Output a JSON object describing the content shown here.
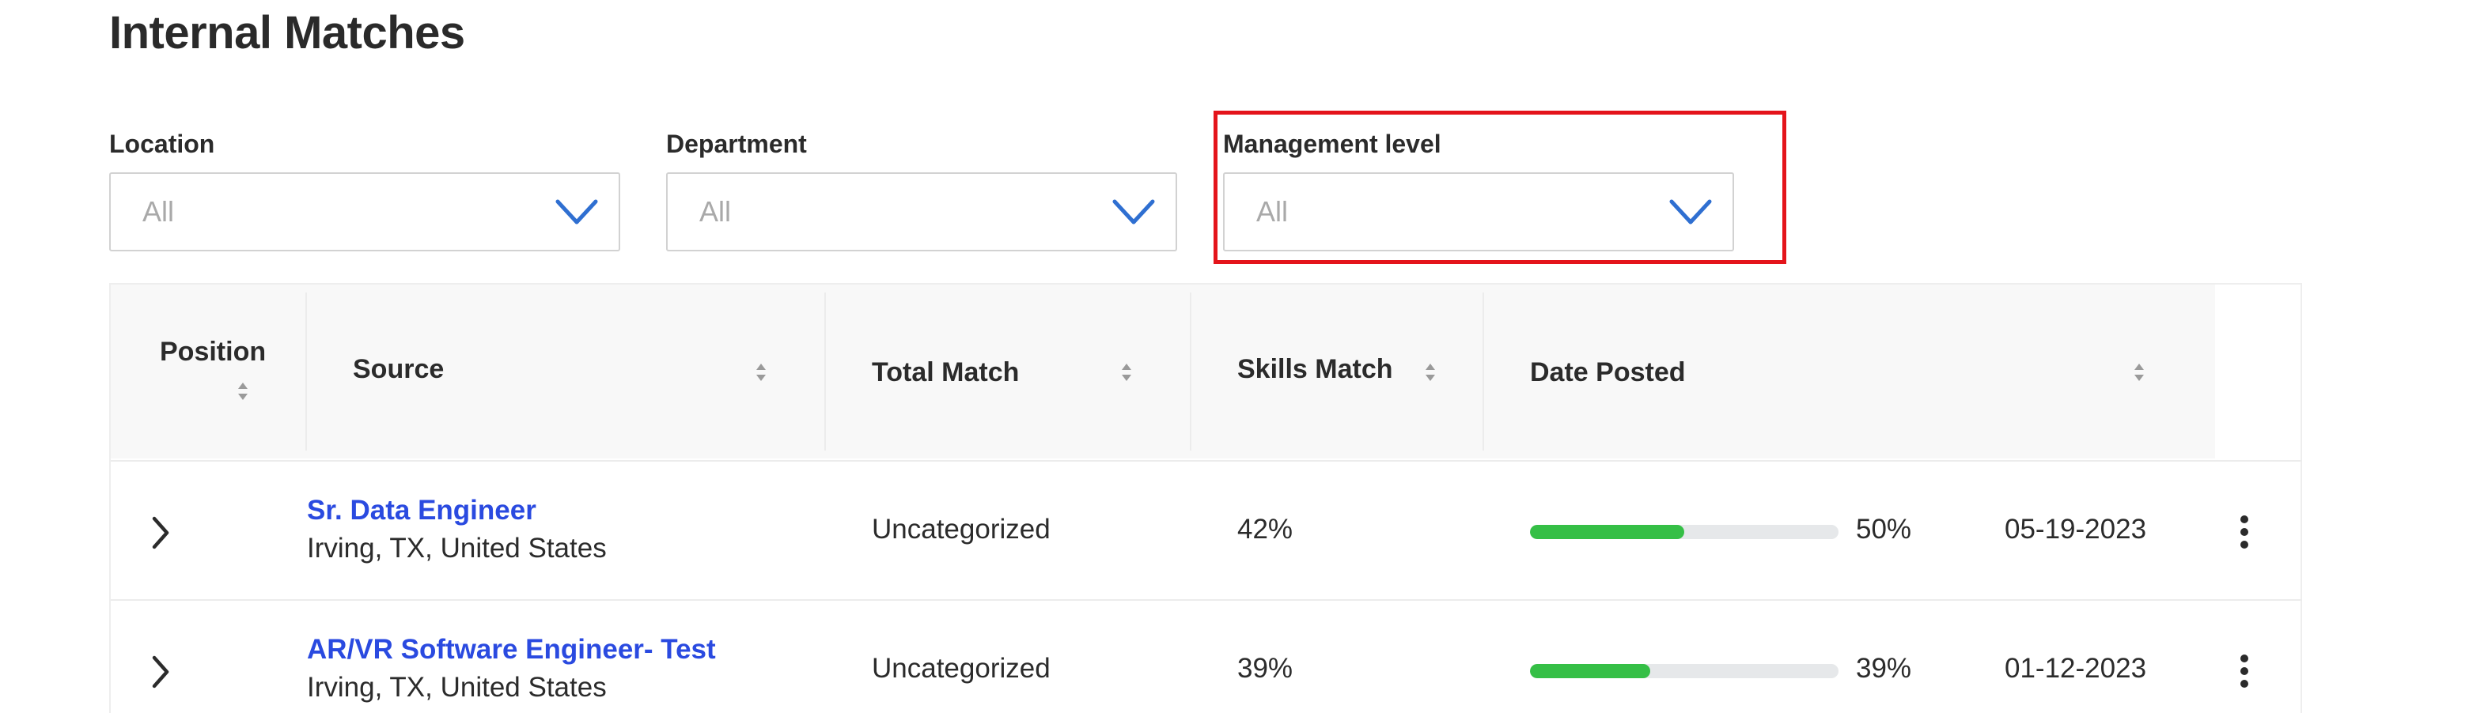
{
  "page": {
    "title": "Internal Matches"
  },
  "filters": [
    {
      "label": "Location",
      "value": "All"
    },
    {
      "label": "Department",
      "value": "All"
    },
    {
      "label": "Management level",
      "value": "All"
    }
  ],
  "table": {
    "columns": [
      "Position",
      "Source",
      "Total Match",
      "Skills Match",
      "Date Posted"
    ],
    "rows": [
      {
        "title": "Sr. Data Engineer",
        "location": "Irving, TX, United States",
        "source": "Uncategorized",
        "total_match": "42%",
        "skills_match_label": "50%",
        "skills_match_fraction": 0.5,
        "date_posted": "05-19-2023"
      },
      {
        "title": "AR/VR Software Engineer- Test",
        "location": "Irving, TX, United States",
        "source": "Uncategorized",
        "total_match": "39%",
        "skills_match_label": "39%",
        "skills_match_fraction": 0.39,
        "date_posted": "01-12-2023"
      }
    ]
  },
  "colors": {
    "accent_blue": "#2a4ae0",
    "chevron_blue": "#2f6fd1",
    "progress_green": "#35bf46",
    "highlight_red": "#e4141b"
  },
  "icons": {
    "dropdown": "chevron-down-icon",
    "sort": "sort-icon",
    "expand": "chevron-right-icon",
    "more": "more-vertical-icon"
  }
}
